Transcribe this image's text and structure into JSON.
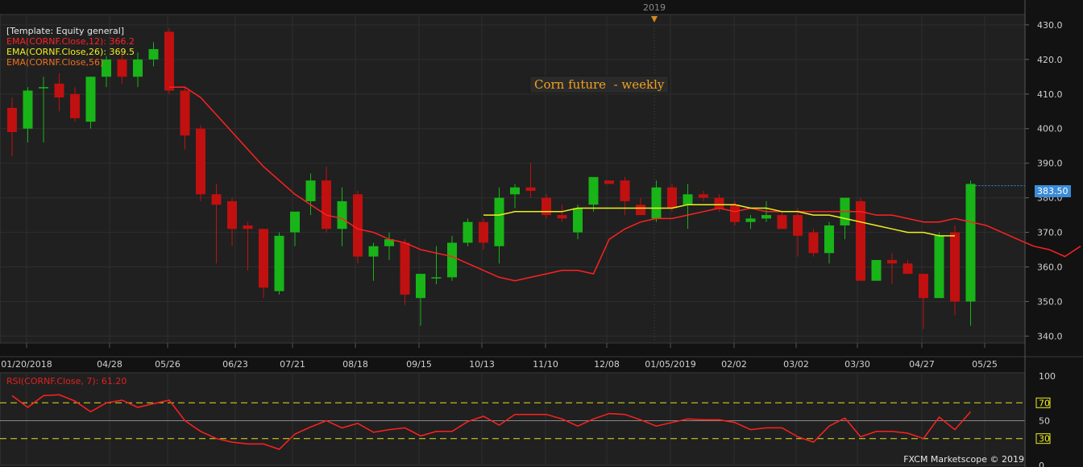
{
  "header": {
    "year": "2019"
  },
  "legend": {
    "template": "[Template: Equity general]",
    "ema12": "EMA(CORNF.Close,12): 366.2",
    "ema26": "EMA(CORNF.Close,26): 369.5",
    "ema56": "EMA(CORNF.Close,56)"
  },
  "title": "Corn future  - weekly",
  "current_price": "383.50",
  "rsi_label": "RSI(CORNF.Close, 7): 61.20",
  "credit": "FXCM Marketscope © 2019",
  "colors": {
    "up": "#18b418",
    "down": "#c01010",
    "ema12": "#ff2020",
    "ema26": "#f0f020",
    "rsi": "#ff2020",
    "level": "#e0e020"
  },
  "chart_data": [
    {
      "type": "candlestick",
      "title": "Corn future  - weekly",
      "ylim": [
        338,
        433
      ],
      "y_ticks": [
        340,
        350,
        360,
        370,
        380,
        390,
        400,
        410,
        420,
        430
      ],
      "x_tick_labels": [
        "01/20/2018",
        "04/28",
        "05/26",
        "06/23",
        "07/21",
        "08/18",
        "09/15",
        "10/13",
        "11/10",
        "12/08",
        "01/05/2019",
        "02/02",
        "03/02",
        "03/30",
        "04/27",
        "05/25"
      ],
      "candles": [
        {
          "o": 406,
          "h": 409,
          "l": 392,
          "c": 399
        },
        {
          "o": 400,
          "h": 412,
          "l": 396,
          "c": 411
        },
        {
          "o": 412,
          "h": 415,
          "l": 396,
          "c": 412
        },
        {
          "o": 413,
          "h": 416,
          "l": 405,
          "c": 409
        },
        {
          "o": 410,
          "h": 412,
          "l": 402,
          "c": 403
        },
        {
          "o": 402,
          "h": 415,
          "l": 400,
          "c": 415
        },
        {
          "o": 415,
          "h": 421,
          "l": 412,
          "c": 420
        },
        {
          "o": 420,
          "h": 422,
          "l": 413,
          "c": 415
        },
        {
          "o": 415,
          "h": 422,
          "l": 412,
          "c": 420
        },
        {
          "o": 420,
          "h": 425,
          "l": 418,
          "c": 423
        },
        {
          "o": 428,
          "h": 429,
          "l": 410,
          "c": 411
        },
        {
          "o": 411,
          "h": 412,
          "l": 394,
          "c": 398
        },
        {
          "o": 400,
          "h": 401,
          "l": 379,
          "c": 381
        },
        {
          "o": 381,
          "h": 384,
          "l": 361,
          "c": 378
        },
        {
          "o": 379,
          "h": 380,
          "l": 366,
          "c": 371
        },
        {
          "o": 372,
          "h": 373,
          "l": 359,
          "c": 371
        },
        {
          "o": 371,
          "h": 371,
          "l": 351,
          "c": 354
        },
        {
          "o": 353,
          "h": 370,
          "l": 352,
          "c": 369
        },
        {
          "o": 370,
          "h": 375,
          "l": 366,
          "c": 376
        },
        {
          "o": 379,
          "h": 387,
          "l": 375,
          "c": 385
        },
        {
          "o": 385,
          "h": 389,
          "l": 370,
          "c": 371
        },
        {
          "o": 371,
          "h": 383,
          "l": 366,
          "c": 379
        },
        {
          "o": 381,
          "h": 382,
          "l": 361,
          "c": 363
        },
        {
          "o": 363,
          "h": 367,
          "l": 356,
          "c": 366
        },
        {
          "o": 366,
          "h": 370,
          "l": 362,
          "c": 368
        },
        {
          "o": 367,
          "h": 368,
          "l": 349,
          "c": 352
        },
        {
          "o": 351,
          "h": 357,
          "l": 343,
          "c": 358
        },
        {
          "o": 357,
          "h": 366,
          "l": 355,
          "c": 357
        },
        {
          "o": 357,
          "h": 369,
          "l": 356,
          "c": 367
        },
        {
          "o": 367,
          "h": 374,
          "l": 366,
          "c": 373
        },
        {
          "o": 373,
          "h": 374,
          "l": 365,
          "c": 367
        },
        {
          "o": 366,
          "h": 383,
          "l": 361,
          "c": 380
        },
        {
          "o": 381,
          "h": 384,
          "l": 377,
          "c": 383
        },
        {
          "o": 383,
          "h": 390,
          "l": 380,
          "c": 382
        },
        {
          "o": 380,
          "h": 381,
          "l": 374,
          "c": 375
        },
        {
          "o": 375,
          "h": 378,
          "l": 373,
          "c": 374
        },
        {
          "o": 370,
          "h": 378,
          "l": 368,
          "c": 377
        },
        {
          "o": 378,
          "h": 386,
          "l": 376,
          "c": 386
        },
        {
          "o": 385,
          "h": 385,
          "l": 384,
          "c": 384
        },
        {
          "o": 385,
          "h": 386,
          "l": 375,
          "c": 379
        },
        {
          "o": 378,
          "h": 380,
          "l": 375,
          "c": 375
        },
        {
          "o": 374,
          "h": 385,
          "l": 373,
          "c": 383
        },
        {
          "o": 383,
          "h": 384,
          "l": 376,
          "c": 377
        },
        {
          "o": 378,
          "h": 384,
          "l": 371,
          "c": 381
        },
        {
          "o": 381,
          "h": 382,
          "l": 379,
          "c": 380
        },
        {
          "o": 380,
          "h": 381,
          "l": 376,
          "c": 377
        },
        {
          "o": 378,
          "h": 379,
          "l": 372,
          "c": 373
        },
        {
          "o": 373,
          "h": 375,
          "l": 371,
          "c": 374
        },
        {
          "o": 374,
          "h": 379,
          "l": 373,
          "c": 375
        },
        {
          "o": 375,
          "h": 376,
          "l": 372,
          "c": 371
        },
        {
          "o": 375,
          "h": 377,
          "l": 363,
          "c": 369
        },
        {
          "o": 370,
          "h": 371,
          "l": 363,
          "c": 364
        },
        {
          "o": 364,
          "h": 373,
          "l": 361,
          "c": 372
        },
        {
          "o": 372,
          "h": 380,
          "l": 368,
          "c": 380
        },
        {
          "o": 379,
          "h": 380,
          "l": 356,
          "c": 356
        },
        {
          "o": 356,
          "h": 362,
          "l": 356,
          "c": 362
        },
        {
          "o": 362,
          "h": 364,
          "l": 355,
          "c": 361
        },
        {
          "o": 361,
          "h": 362,
          "l": 358,
          "c": 358
        },
        {
          "o": 358,
          "h": 358,
          "l": 342,
          "c": 351
        },
        {
          "o": 351,
          "h": 370,
          "l": 351,
          "c": 369
        },
        {
          "o": 370,
          "h": 372,
          "l": 346,
          "c": 350
        },
        {
          "o": 350,
          "h": 385,
          "l": 343,
          "c": 384
        }
      ],
      "series": [
        {
          "name": "EMA(CORNF.Close,12)",
          "start_index": 10,
          "values": [
            412,
            412,
            409,
            404,
            399,
            394,
            389,
            385,
            381,
            378,
            375,
            374,
            371,
            370,
            368,
            367,
            365,
            364,
            363,
            361,
            359,
            357,
            356,
            357,
            358,
            359,
            359,
            358,
            368,
            371,
            373,
            374,
            374,
            375,
            376,
            377,
            376,
            377,
            376,
            376,
            376,
            376,
            376,
            376,
            376,
            375,
            375,
            374,
            373,
            373,
            374,
            373,
            372,
            370,
            368,
            366,
            365,
            363,
            366
          ]
        },
        {
          "name": "EMA(CORNF.Close,26)",
          "start_index": 30,
          "values": [
            375,
            375,
            376,
            376,
            376,
            376,
            377,
            377,
            377,
            377,
            377,
            377,
            377,
            378,
            378,
            378,
            378,
            377,
            377,
            376,
            376,
            375,
            375,
            374,
            373,
            372,
            371,
            370,
            370,
            369,
            369
          ]
        }
      ],
      "current_price": 383.5
    },
    {
      "type": "line",
      "ylabel": "RSI(CORNF.Close, 7): 61.20",
      "ylim": [
        0,
        100
      ],
      "y_ticks": [
        30,
        50,
        70
      ],
      "y_axis_labels": [
        100,
        70,
        50,
        30,
        0
      ],
      "levels": [
        70,
        30
      ],
      "series": [
        {
          "name": "RSI(CORNF.Close, 7)",
          "values": [
            78,
            65,
            78,
            79,
            72,
            60,
            70,
            73,
            65,
            69,
            73,
            50,
            38,
            30,
            26,
            24,
            24,
            18,
            35,
            43,
            50,
            42,
            47,
            37,
            40,
            42,
            33,
            38,
            38,
            49,
            55,
            45,
            57,
            57,
            57,
            52,
            44,
            52,
            58,
            57,
            51,
            44,
            48,
            52,
            51,
            51,
            48,
            40,
            42,
            42,
            32,
            26,
            44,
            53,
            32,
            38,
            38,
            36,
            30,
            54,
            40,
            60
          ]
        }
      ]
    }
  ]
}
